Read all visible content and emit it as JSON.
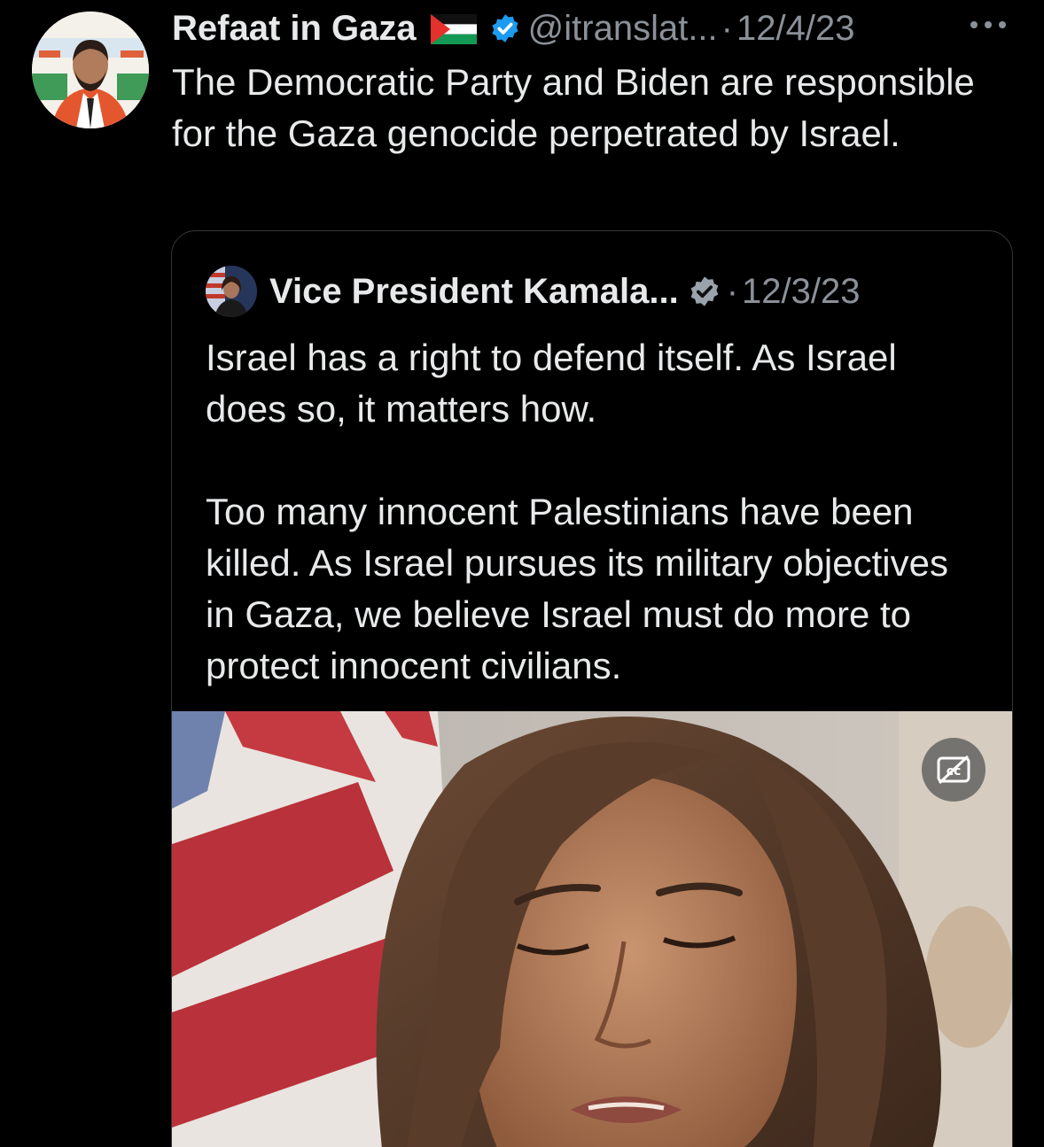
{
  "tweet": {
    "author": {
      "display_name": "Refaat in Gaza",
      "flag_emoji": "palestine-flag",
      "verified": true,
      "handle": "@itranslat...",
      "separator": "·",
      "date": "12/4/23"
    },
    "text": "The Democratic Party and Biden are responsible for the Gaza genocide perpetrated by Israel.",
    "more_icon": "more-horizontal-icon"
  },
  "quoted_tweet": {
    "author": {
      "display_name": "Vice President Kamala...",
      "verified": true,
      "verified_color": "#9aa3ab",
      "separator": "·",
      "date": "12/3/23"
    },
    "paragraphs": [
      "Israel has a right to defend itself. As Israel does so, it matters how.",
      "Too many innocent Palestinians have been killed. As Israel pursues its military objectives in Gaza, we believe Israel must do more to protect innocent civilians."
    ],
    "media": {
      "type": "video",
      "caption_icon": "closed-captions-off-icon"
    }
  },
  "colors": {
    "background": "#000000",
    "primary_text": "#e7e9ea",
    "secondary_text": "#8b9198",
    "verified_blue": "#1d9bf0",
    "border": "#333639"
  }
}
